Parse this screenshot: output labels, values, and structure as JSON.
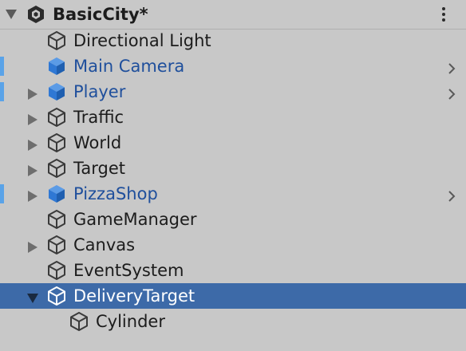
{
  "scene": {
    "name": "BasicCity*",
    "expanded": true
  },
  "colors": {
    "background": "#c8c8c8",
    "selection": "#3d6aa8",
    "prefab_text": "#1f4f9c",
    "prefab_marker": "#5aa3e8",
    "prefab_icon": "#2f78d4"
  },
  "hierarchy": [
    {
      "label": "Directional Light",
      "icon": "cube-outline-icon",
      "expander": "none",
      "prefab": false,
      "selected": false,
      "chevron": false
    },
    {
      "label": "Main Camera",
      "icon": "cube-prefab-icon",
      "expander": "none",
      "prefab": true,
      "selected": false,
      "chevron": true
    },
    {
      "label": "Player",
      "icon": "cube-prefab-icon",
      "expander": "collapsed",
      "prefab": true,
      "selected": false,
      "chevron": true
    },
    {
      "label": "Traffic",
      "icon": "cube-outline-icon",
      "expander": "collapsed",
      "prefab": false,
      "selected": false,
      "chevron": false
    },
    {
      "label": "World",
      "icon": "cube-outline-icon",
      "expander": "collapsed",
      "prefab": false,
      "selected": false,
      "chevron": false
    },
    {
      "label": "Target",
      "icon": "cube-outline-icon",
      "expander": "collapsed",
      "prefab": false,
      "selected": false,
      "chevron": false
    },
    {
      "label": "PizzaShop",
      "icon": "cube-prefab-icon",
      "expander": "collapsed",
      "prefab": true,
      "selected": false,
      "chevron": true
    },
    {
      "label": "GameManager",
      "icon": "cube-outline-icon",
      "expander": "none",
      "prefab": false,
      "selected": false,
      "chevron": false
    },
    {
      "label": "Canvas",
      "icon": "cube-outline-icon",
      "expander": "collapsed",
      "prefab": false,
      "selected": false,
      "chevron": false
    },
    {
      "label": "EventSystem",
      "icon": "cube-outline-icon",
      "expander": "none",
      "prefab": false,
      "selected": false,
      "chevron": false
    },
    {
      "label": "DeliveryTarget",
      "icon": "cube-outline-icon",
      "expander": "expanded",
      "prefab": false,
      "selected": true,
      "chevron": false
    },
    {
      "label": "Cylinder",
      "icon": "cube-outline-icon",
      "expander": "none",
      "prefab": false,
      "selected": false,
      "chevron": false,
      "child": true
    }
  ]
}
